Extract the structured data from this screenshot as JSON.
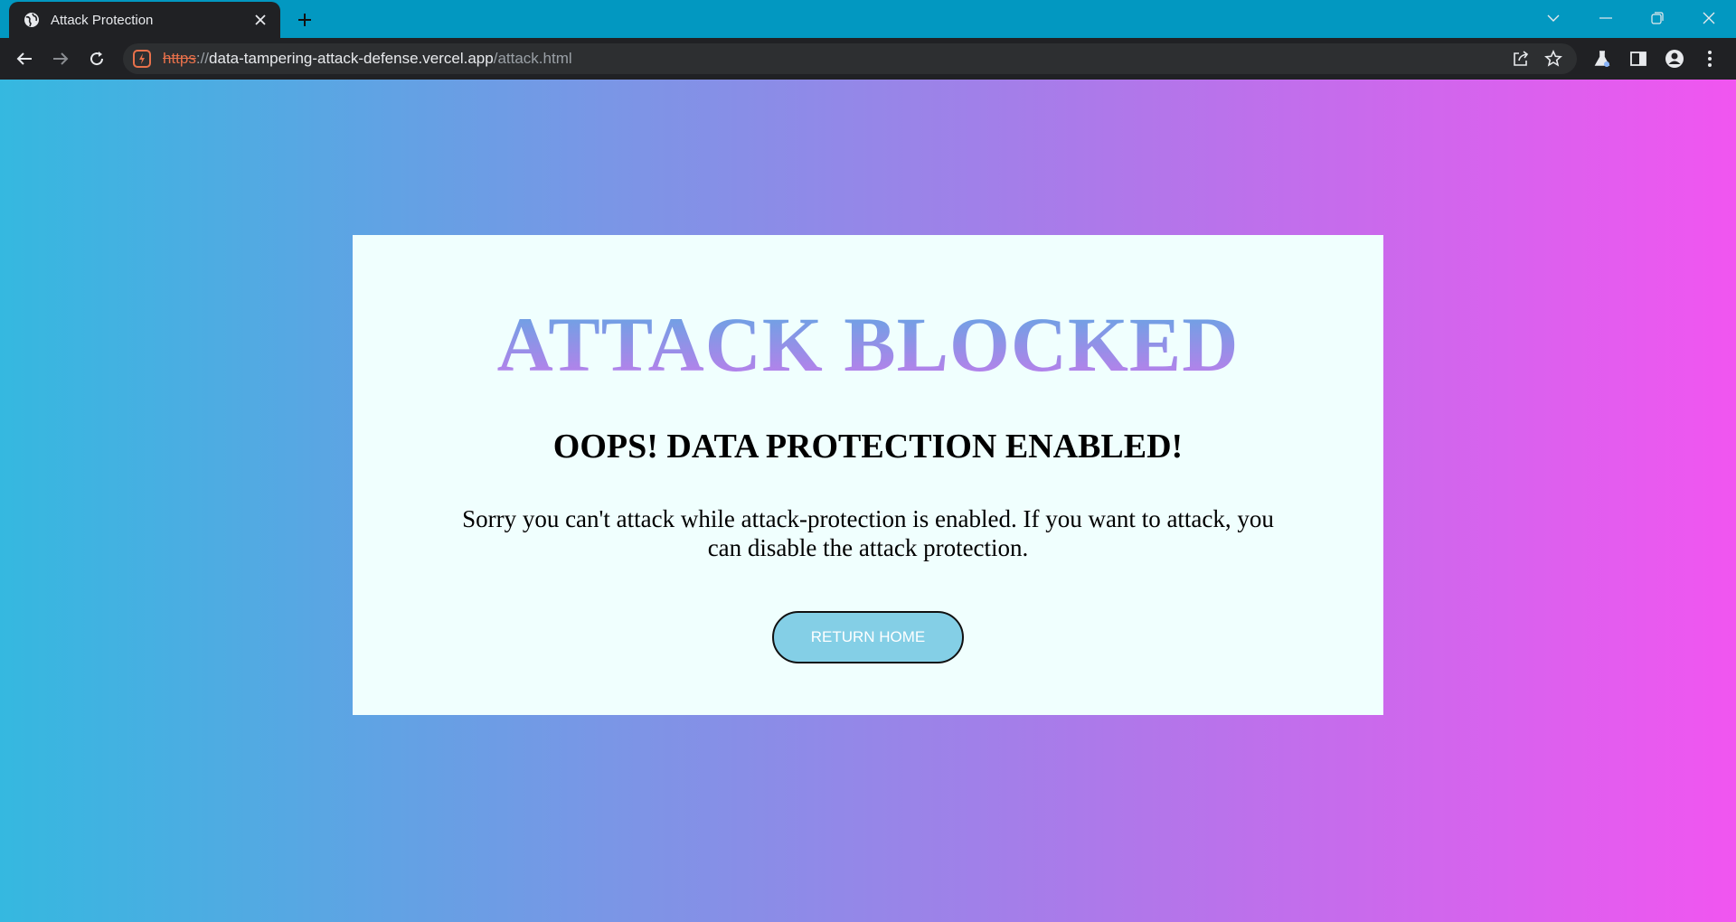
{
  "browser": {
    "tab": {
      "title": "Attack Protection"
    },
    "address_bar": {
      "scheme": "https",
      "separator": "://",
      "host": "data-tampering-attack-defense.vercel.app",
      "path": "/attack.html"
    }
  },
  "page": {
    "headline": "ATTACK BLOCKED",
    "subheadline": "OOPS! DATA PROTECTION ENABLED!",
    "message": "Sorry you can't attack while attack-protection is enabled. If you want to attack, you can disable the attack protection.",
    "return_button": "RETURN HOME"
  },
  "colors": {
    "tab_strip": "#0298c1",
    "toolbar": "#202124",
    "card_background": "#f0fffe",
    "button_background": "#84cfe6",
    "gradient_start": "#35b8e0",
    "gradient_end": "#f155f0"
  }
}
